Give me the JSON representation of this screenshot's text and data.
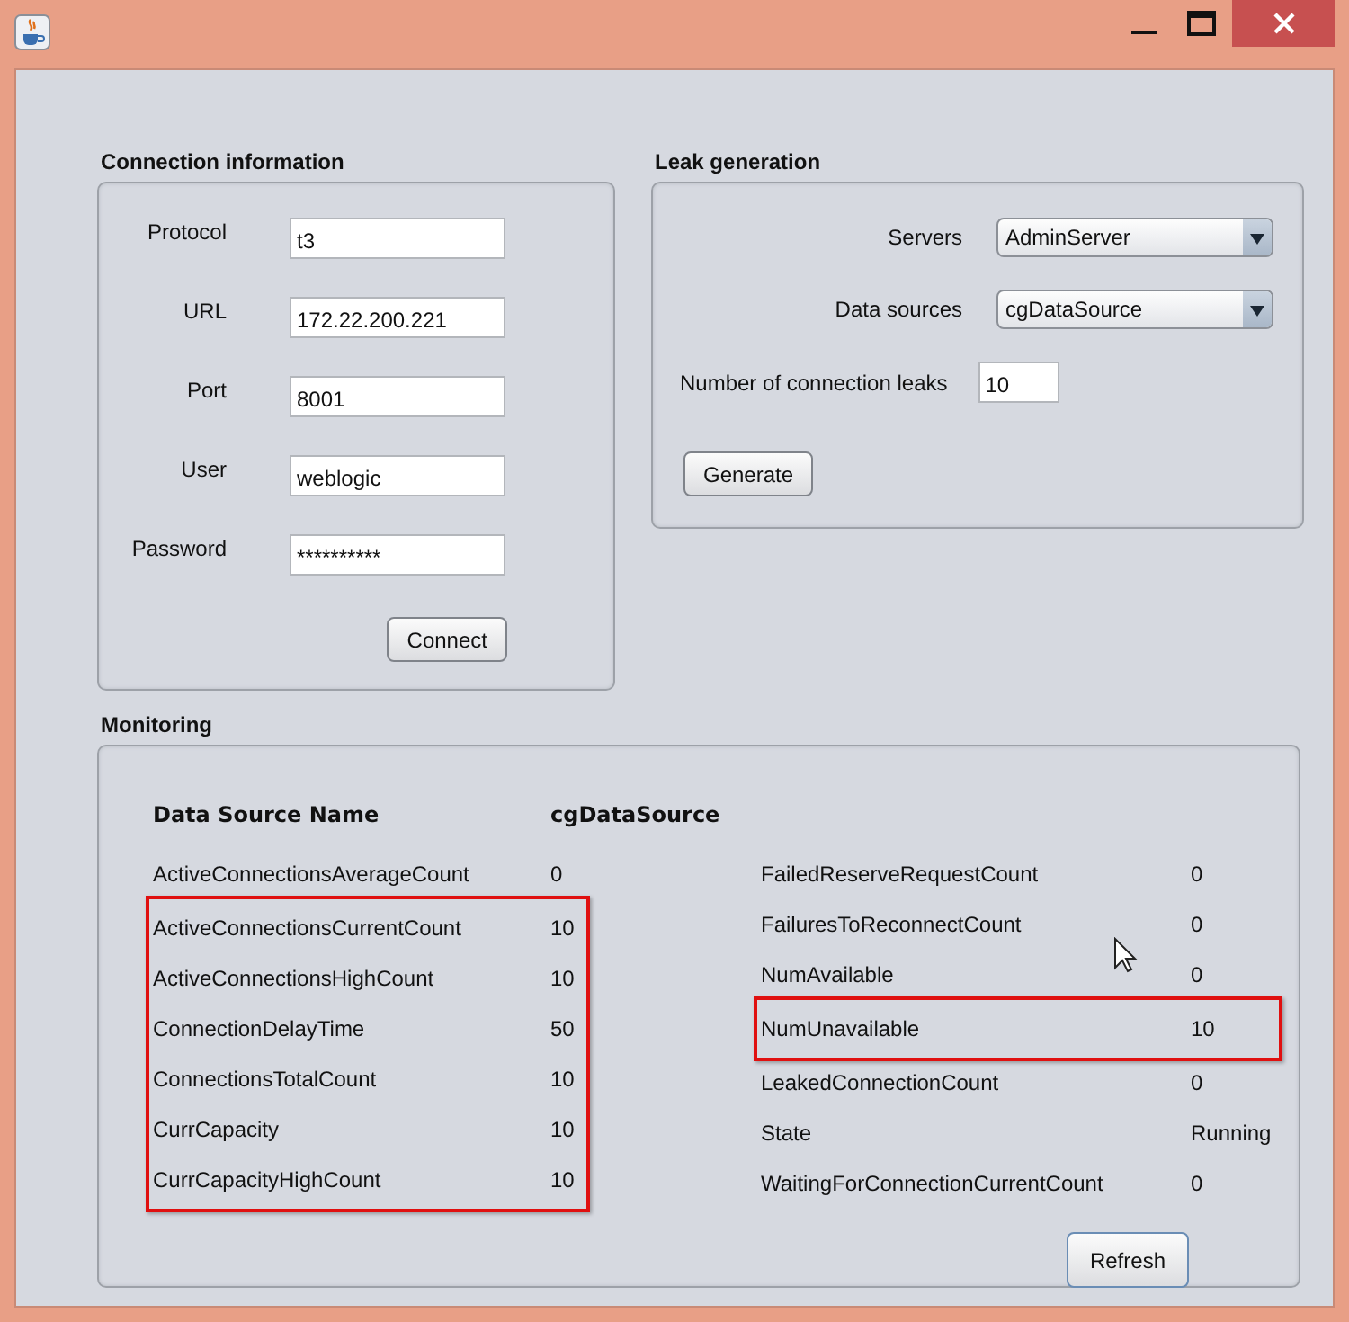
{
  "connection": {
    "title": "Connection information",
    "fields": [
      {
        "label": "Protocol",
        "value": "t3"
      },
      {
        "label": "URL",
        "value": "172.22.200.221"
      },
      {
        "label": "Port",
        "value": "8001"
      },
      {
        "label": "User",
        "value": "weblogic"
      },
      {
        "label": "Password",
        "value": "**********"
      }
    ],
    "button": "Connect"
  },
  "leak": {
    "title": "Leak generation",
    "selects": [
      {
        "label": "Servers",
        "value": "AdminServer"
      },
      {
        "label": "Data sources",
        "value": "cgDataSource"
      }
    ],
    "count": {
      "label": "Number of connection leaks",
      "value": "10"
    },
    "button": "Generate"
  },
  "monitoring": {
    "title": "Monitoring",
    "header": {
      "name": "Data Source Name",
      "value": "cgDataSource"
    },
    "columns": [
      {
        "groups": [
          {
            "highlighted": false,
            "rows": [
              {
                "name": "ActiveConnectionsAverageCount",
                "value": "0"
              }
            ]
          },
          {
            "highlighted": true,
            "rows": [
              {
                "name": "ActiveConnectionsCurrentCount",
                "value": "10"
              },
              {
                "name": "ActiveConnectionsHighCount",
                "value": "10"
              },
              {
                "name": "ConnectionDelayTime",
                "value": "50"
              },
              {
                "name": "ConnectionsTotalCount",
                "value": "10"
              },
              {
                "name": "CurrCapacity",
                "value": "10"
              },
              {
                "name": "CurrCapacityHighCount",
                "value": "10"
              }
            ]
          }
        ]
      },
      {
        "groups": [
          {
            "highlighted": false,
            "rows": [
              {
                "name": "FailedReserveRequestCount",
                "value": "0"
              },
              {
                "name": "FailuresToReconnectCount",
                "value": "0"
              },
              {
                "name": "NumAvailable",
                "value": "0"
              }
            ]
          },
          {
            "highlighted": true,
            "rows": [
              {
                "name": "NumUnavailable",
                "value": "10"
              }
            ]
          },
          {
            "highlighted": false,
            "rows": [
              {
                "name": "LeakedConnectionCount",
                "value": "0"
              },
              {
                "name": "State",
                "value": "Running"
              },
              {
                "name": "WaitingForConnectionCurrentCount",
                "value": "0"
              }
            ]
          }
        ]
      }
    ],
    "button": "Refresh"
  }
}
